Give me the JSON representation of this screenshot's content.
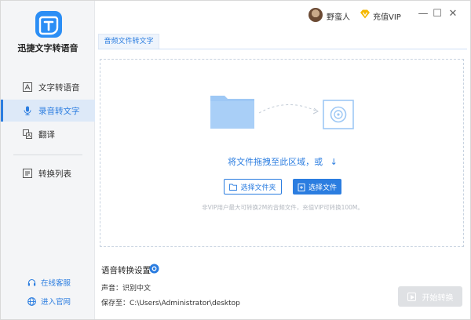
{
  "app": {
    "name": "迅捷文字转语音"
  },
  "sidebar": {
    "items": [
      {
        "label": "文字转语音",
        "icon": "text-image-icon"
      },
      {
        "label": "录音转文字",
        "icon": "microphone-icon",
        "active": true
      },
      {
        "label": "翻译",
        "icon": "translate-icon"
      },
      {
        "label": "转换列表",
        "icon": "list-icon"
      }
    ],
    "footer": [
      {
        "label": "在线客服",
        "icon": "headset-icon"
      },
      {
        "label": "进入官网",
        "icon": "globe-icon"
      }
    ]
  },
  "titlebar": {
    "username": "野蛮人",
    "vip_label": "充值VIP",
    "minimize": "—",
    "maximize": "☐",
    "close": "✕"
  },
  "tabs": [
    {
      "label": "音频文件转文字"
    }
  ],
  "dropzone": {
    "text": "将文件拖拽至此区域，或",
    "arrow": "↓",
    "folder_button": "选择文件夹",
    "file_button": "选择文件",
    "hint": "非VIP用户最大可转换2M的音频文件，充值VIP可转换100M。"
  },
  "settings": {
    "title": "语音转换设置",
    "voice_line": "声音：识别中文",
    "save_line": "保存至：C:\\Users\\Administrator\\desktop"
  },
  "start_button": "开始转换",
  "colors": {
    "accent": "#2b7de0",
    "sidebar_bg": "#f4f5f7",
    "disabled": "#dfe1e4"
  }
}
